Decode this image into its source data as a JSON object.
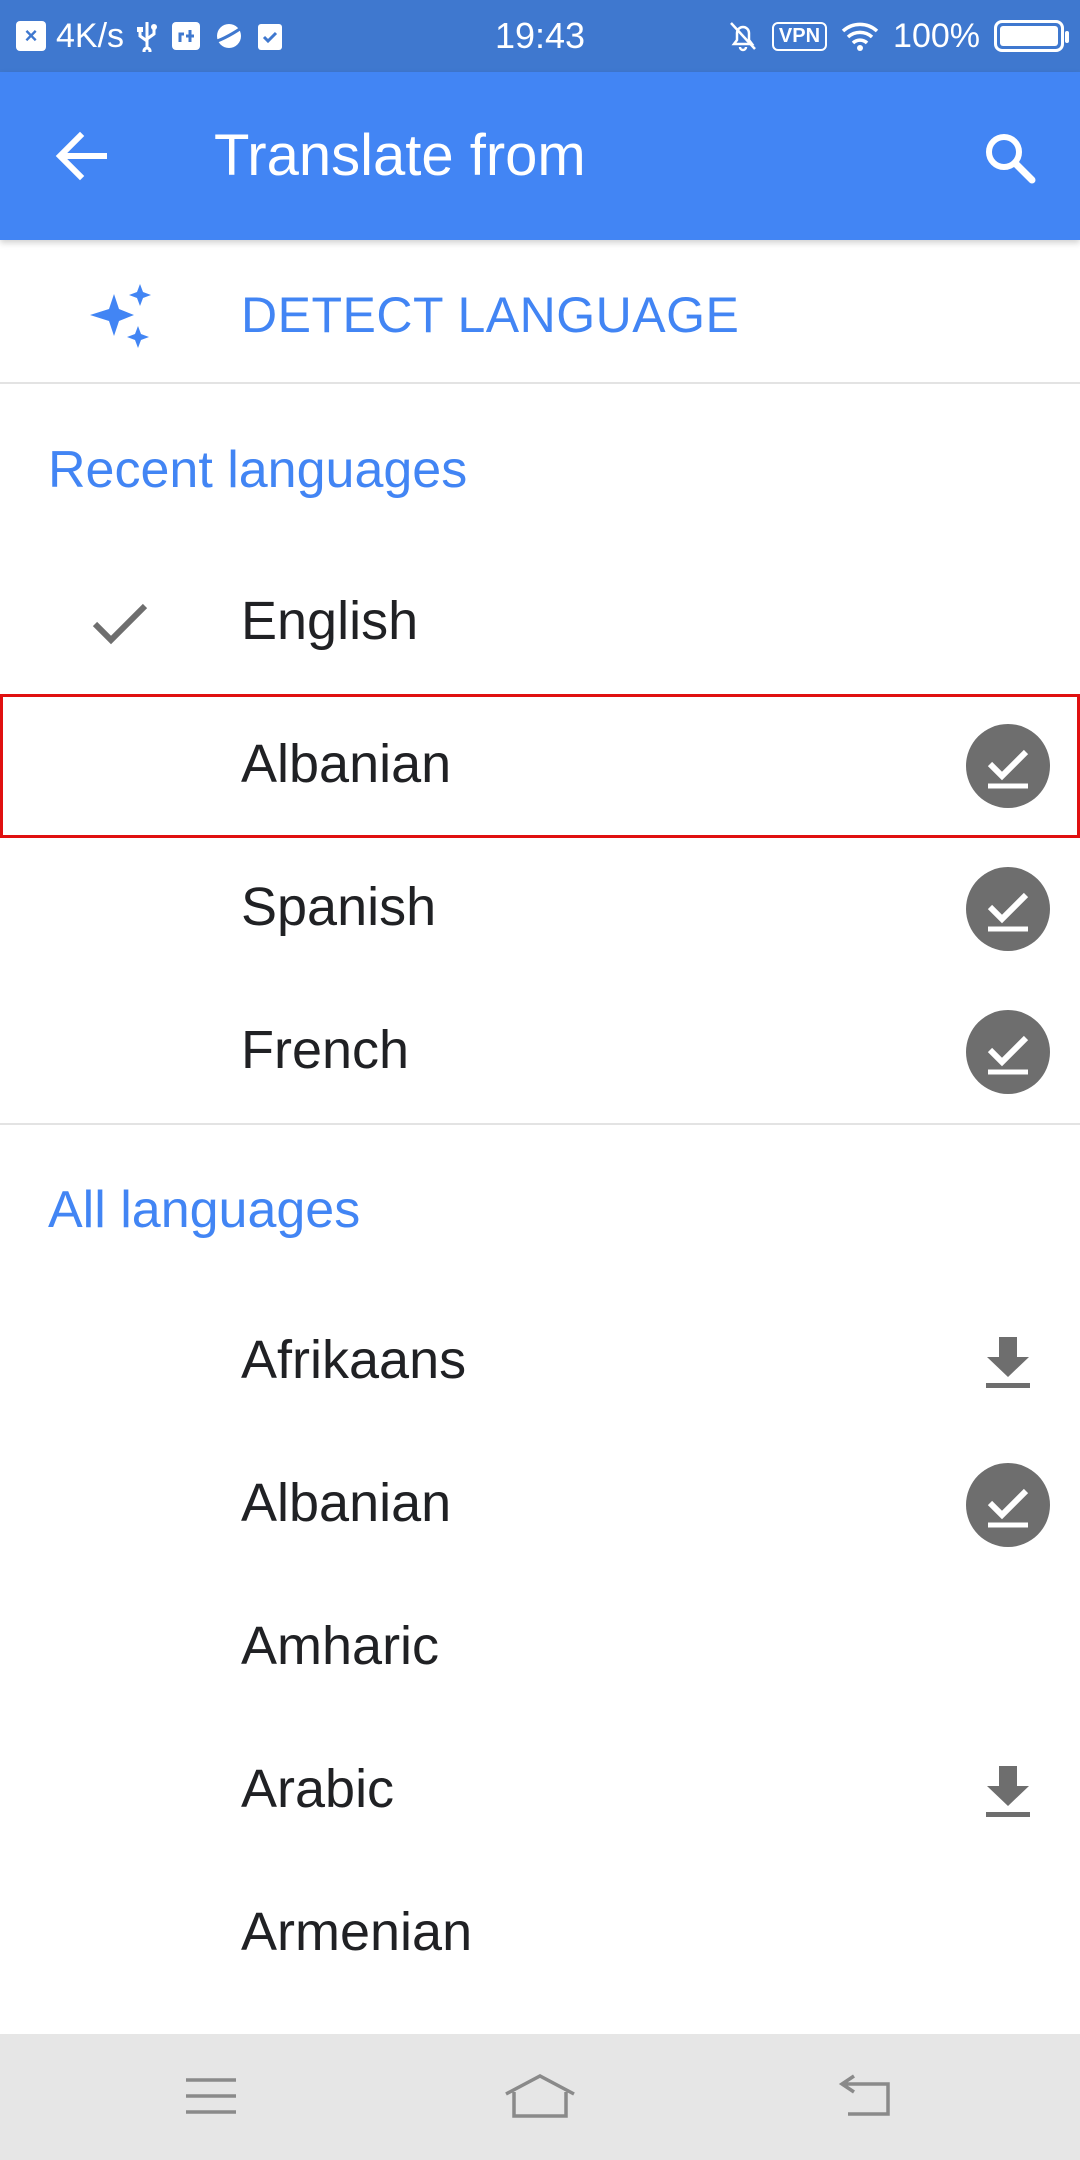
{
  "status_bar": {
    "speed": "4K/s",
    "time": "19:43",
    "vpn": "VPN",
    "battery": "100%",
    "icons": [
      "x-box-icon",
      "usb-icon",
      "debug-icon",
      "planet-icon",
      "clipboard-check-icon",
      "bell-off-icon",
      "wifi-icon",
      "battery-icon"
    ]
  },
  "app_bar": {
    "title": "Translate from",
    "back_icon": "arrow-back-icon",
    "search_icon": "search-icon"
  },
  "detect": {
    "label": "DETECT LANGUAGE",
    "icon": "sparkle-icon"
  },
  "recent": {
    "header": "Recent languages",
    "items": [
      {
        "name": "English",
        "selected": true,
        "status": "none"
      },
      {
        "name": "Albanian",
        "selected": false,
        "status": "downloaded",
        "highlighted": true
      },
      {
        "name": "Spanish",
        "selected": false,
        "status": "downloaded"
      },
      {
        "name": "French",
        "selected": false,
        "status": "downloaded"
      }
    ]
  },
  "all": {
    "header": "All languages",
    "items": [
      {
        "name": "Afrikaans",
        "status": "download"
      },
      {
        "name": "Albanian",
        "status": "downloaded"
      },
      {
        "name": "Amharic",
        "status": "none"
      },
      {
        "name": "Arabic",
        "status": "download"
      },
      {
        "name": "Armenian",
        "status": "none"
      }
    ]
  },
  "nav_bar": {
    "icons": [
      "menu-icon",
      "home-icon",
      "back-icon"
    ]
  },
  "colors": {
    "status_bar": "#3f78cf",
    "app_bar": "#4285f4",
    "accent": "#4285f4",
    "badge": "#6e6e6e",
    "highlight": "#e01010"
  }
}
